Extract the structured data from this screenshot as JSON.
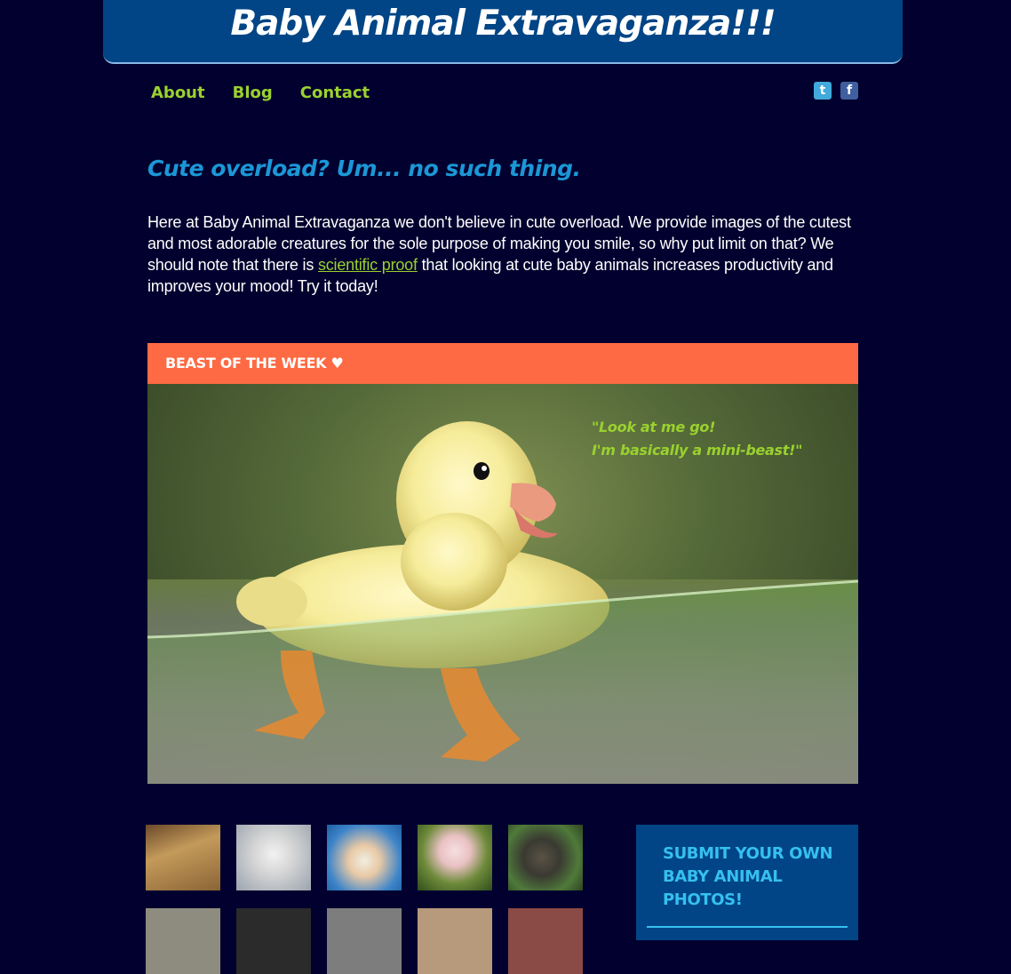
{
  "site": {
    "title": "Baby Animal Extravaganza!!!"
  },
  "nav": {
    "items": [
      "About",
      "Blog",
      "Contact"
    ]
  },
  "social": {
    "twitter_icon": "twitter-icon",
    "facebook_icon": "facebook-icon",
    "twitter_glyph": "t",
    "facebook_glyph": "f"
  },
  "main": {
    "tagline": "Cute overload? Um... no such thing.",
    "intro_before_link": "Here at Baby Animal Extravaganza we don't believe in cute overload. We provide images of the cutest and most adorable creatures for the sole purpose of making you smile, so why put limit on that? We should note that there is ",
    "intro_link": "scientific proof",
    "intro_after_link": " that looking at cute baby animals increases productivity and improves your mood! Try it today!"
  },
  "beast": {
    "heading": "BEAST OF THE WEEK ♥",
    "quote_line1": "\"Look at me go!",
    "quote_line2": "I'm basically a mini-beast!\""
  },
  "gallery": {
    "thumbs": [
      "baby-giraffe",
      "baby-rat",
      "baby-pufferfish",
      "baby-piglet",
      "baby-hippo"
    ]
  },
  "submit": {
    "label": "SUBMIT YOUR OWN BABY ANIMAL PHOTOS!"
  },
  "colors": {
    "page_bg": "#02002e",
    "header_bg": "#014586",
    "nav_link": "#9ad12f",
    "tagline": "#1b97d6",
    "beast_bar": "#fe6a43",
    "submit_text": "#36c0ee"
  }
}
